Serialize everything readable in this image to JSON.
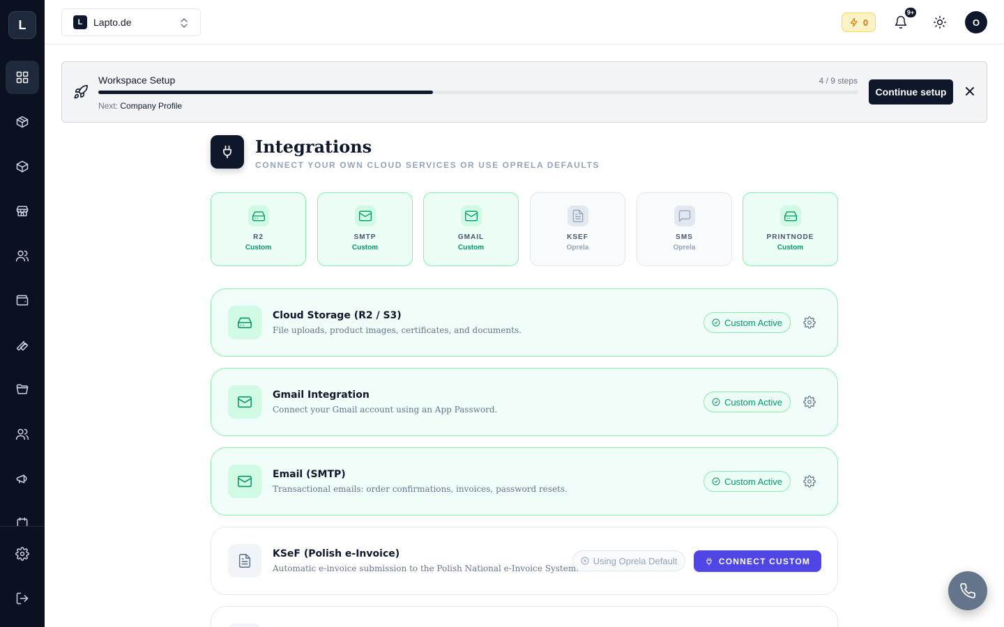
{
  "sidebar": {
    "logo_letter": "L",
    "items": [
      {
        "icon": "dashboard-icon"
      },
      {
        "icon": "package-icon"
      },
      {
        "icon": "box-icon"
      },
      {
        "icon": "store-icon"
      },
      {
        "icon": "users-icon"
      },
      {
        "icon": "wallet-icon"
      },
      {
        "icon": "wrench-icon"
      },
      {
        "icon": "folder-icon"
      },
      {
        "icon": "team-icon"
      },
      {
        "icon": "megaphone-icon"
      }
    ],
    "bottom": [
      {
        "icon": "settings-icon"
      },
      {
        "icon": "logout-icon"
      }
    ]
  },
  "topbar": {
    "workspace_letter": "L",
    "workspace_name": "Lapto.de",
    "credits": "0",
    "notifications_badge": "9+",
    "avatar_letter": "O"
  },
  "setup": {
    "title": "Workspace Setup",
    "steps_label": "4 / 9 steps",
    "progress": 0.44,
    "next_prefix": "Next:",
    "next_step": "Company Profile",
    "continue_label": "Continue setup"
  },
  "header": {
    "title": "Integrations",
    "subtitle": "CONNECT YOUR OWN CLOUD SERVICES OR USE OPRELA DEFAULTS"
  },
  "tiles": [
    {
      "name": "R2",
      "state": "Custom",
      "kind": "custom",
      "icon": "drive-icon"
    },
    {
      "name": "SMTP",
      "state": "Custom",
      "kind": "custom",
      "icon": "mail-icon"
    },
    {
      "name": "GMAIL",
      "state": "Custom",
      "kind": "custom",
      "icon": "mail-icon"
    },
    {
      "name": "KSEF",
      "state": "Oprela",
      "kind": "default",
      "icon": "document-icon"
    },
    {
      "name": "SMS",
      "state": "Oprela",
      "kind": "default",
      "icon": "message-icon"
    },
    {
      "name": "PRINTNODE",
      "state": "Custom",
      "kind": "custom",
      "icon": "drive-icon"
    }
  ],
  "cards": [
    {
      "title": "Cloud Storage (R2 / S3)",
      "desc": "File uploads, product images, certificates, and documents.",
      "status": "Custom Active"
    },
    {
      "title": "Gmail Integration",
      "desc": "Connect your Gmail account using an App Password.",
      "status": "Custom Active"
    },
    {
      "title": "Email (SMTP)",
      "desc": "Transactional emails: order confirmations, invoices, password resets.",
      "status": "Custom Active"
    },
    {
      "title": "KSeF (Polish e-Invoice)",
      "desc": "Automatic e-invoice submission to the Polish National e-Invoice System.",
      "status": "Using Oprela Default",
      "action": "CONNECT CUSTOM"
    }
  ],
  "colors": {
    "sidebar_bg": "#0b1120",
    "custom_green": "#059669",
    "connect_indigo": "#4f46e5",
    "credit_amber": "#d97706"
  }
}
